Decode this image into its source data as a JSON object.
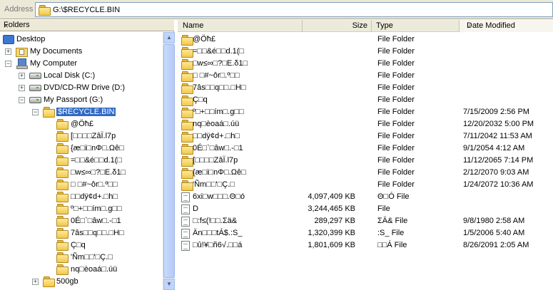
{
  "address": {
    "label": "Address",
    "path": "G:\\$RECYCLE.BIN"
  },
  "folders_pane": {
    "title": "Folders",
    "close": "×",
    "tree": [
      {
        "label": "Desktop"
      },
      {
        "label": "My Documents"
      },
      {
        "label": "My Computer"
      },
      {
        "label": "Local Disk (C:)"
      },
      {
        "label": "DVD/CD-RW Drive (D:)"
      },
      {
        "label": "My Passport (G:)"
      },
      {
        "label": "$RECYCLE.BIN"
      },
      {
        "label": "@Öħ£"
      },
      {
        "label": "[□□□□ZâÏ.l7p"
      },
      {
        "label": "{æ□i□nΦ□.Ωê□"
      },
      {
        "label": "=□□&é□□d.1(□"
      },
      {
        "label": "□w≤∞□?□E.δ1□"
      },
      {
        "label": "□ □#~ôr□.º□□"
      },
      {
        "label": "□□dÿ¢d+.□h□"
      },
      {
        "label": "º□+□□ím□.g□□"
      },
      {
        "label": "0É□`□âw□.-□1"
      },
      {
        "label": "7âs□□q□□.□H□"
      },
      {
        "label": "Ç□q"
      },
      {
        "label": "'Ñm□□'□Ç.□"
      },
      {
        "label": "nq□èoaá□.úü"
      },
      {
        "label": "500gb"
      }
    ]
  },
  "columns": {
    "name": "Name",
    "size": "Size",
    "type": "Type",
    "date": "Date Modified"
  },
  "files": [
    {
      "name": "@Öħ£",
      "size": "",
      "type": "File Folder",
      "date": ""
    },
    {
      "name": "=□□&é□□d.1(□",
      "size": "",
      "type": "File Folder",
      "date": ""
    },
    {
      "name": "□w≤∞□?□E.δ1□",
      "size": "",
      "type": "File Folder",
      "date": ""
    },
    {
      "name": "□ □#~ôr□.º□□",
      "size": "",
      "type": "File Folder",
      "date": ""
    },
    {
      "name": "7âs□□q□□.□H□",
      "size": "",
      "type": "File Folder",
      "date": ""
    },
    {
      "name": "Ç□q",
      "size": "",
      "type": "File Folder",
      "date": ""
    },
    {
      "name": "º□+□□ím□.g□□",
      "size": "",
      "type": "File Folder",
      "date": "7/15/2009 2:56 PM"
    },
    {
      "name": "nq□èoaá□.úü",
      "size": "",
      "type": "File Folder",
      "date": "12/20/2032 5:00 PM"
    },
    {
      "name": "□□dÿ¢d+.□h□",
      "size": "",
      "type": "File Folder",
      "date": "7/11/2042 11:53 AM"
    },
    {
      "name": "0É□`□âw□.-□1",
      "size": "",
      "type": "File Folder",
      "date": "9/1/2054 4:12 AM"
    },
    {
      "name": "[□□□□ZâÏ.l7p",
      "size": "",
      "type": "File Folder",
      "date": "11/12/2065 7:14 PM"
    },
    {
      "name": "{æ□i□nΦ□.Ωê□",
      "size": "",
      "type": "File Folder",
      "date": "2/12/2070 9:03 AM"
    },
    {
      "name": "'Ñm□□'□Ç.□",
      "size": "",
      "type": "File Folder",
      "date": "1/24/2072 10:36 AM"
    },
    {
      "name": "6xi□w□□□.Θ□ó",
      "size": "4,097,409 KB",
      "type": "Θ□Ó File",
      "date": ""
    },
    {
      "name": "D",
      "size": "3,244,465 KB",
      "type": "File",
      "date": ""
    },
    {
      "name": "□:f≤(!□□.Σä&",
      "size": "289,297 KB",
      "type": "ΣÄ& File",
      "date": "9/8/1980 2:58 AM"
    },
    {
      "name": "Än□□□tÁ$.:S_",
      "size": "1,320,399 KB",
      "type": ":S_ File",
      "date": "1/5/2006 5:40 AM"
    },
    {
      "name": "□û!¥□ñ6√.□□á",
      "size": "1,801,609 KB",
      "type": "□□Á File",
      "date": "8/26/2091 2:05 AM"
    }
  ]
}
